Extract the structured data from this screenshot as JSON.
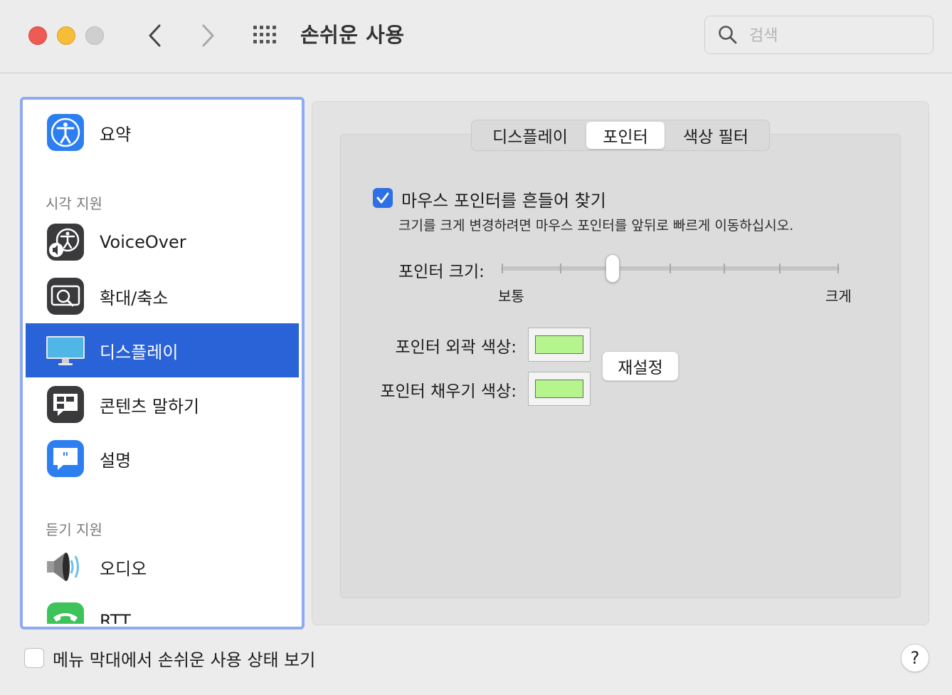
{
  "window": {
    "title": "손쉬운 사용",
    "search_placeholder": "검색"
  },
  "sidebar": {
    "items": [
      {
        "label": "요약",
        "icon": "accessibility-summary-icon"
      },
      {
        "label": "VoiceOver",
        "icon": "voiceover-icon"
      },
      {
        "label": "확대/축소",
        "icon": "zoom-icon"
      },
      {
        "label": "디스플레이",
        "icon": "display-icon",
        "selected": true
      },
      {
        "label": "콘텐츠 말하기",
        "icon": "spoken-content-icon"
      },
      {
        "label": "설명",
        "icon": "descriptions-icon"
      },
      {
        "label": "오디오",
        "icon": "speaker-icon"
      },
      {
        "label": "RTT",
        "icon": "rtt-phone-icon"
      }
    ],
    "sections": {
      "vision": "시각 지원",
      "hearing": "듣기 지원"
    }
  },
  "tabs": [
    {
      "label": "디스플레이",
      "selected": false
    },
    {
      "label": "포인터",
      "selected": true
    },
    {
      "label": "색상 필터",
      "selected": false
    }
  ],
  "pointer": {
    "shake_label": "마우스 포인터를 흔들어 찾기",
    "shake_checked": true,
    "shake_description": "크기를 크게 변경하려면 마우스 포인터를 앞뒤로 빠르게 이동하십시오.",
    "size_label": "포인터 크기:",
    "size_min_label": "보통",
    "size_max_label": "크게",
    "size_value_fraction": 0.33,
    "outline_color_label": "포인터 외곽 색상:",
    "outline_color": "#b6f48e",
    "fill_color_label": "포인터 채우기 색상:",
    "fill_color": "#b6f48e",
    "reset_label": "재설정"
  },
  "footer": {
    "menu_status_label": "메뉴 막대에서 손쉬운 사용 상태 보기",
    "menu_status_checked": false,
    "help_label": "?"
  },
  "colors": {
    "accent": "#2a62d8",
    "sidebar_focus_ring": "#8eaaf0"
  }
}
